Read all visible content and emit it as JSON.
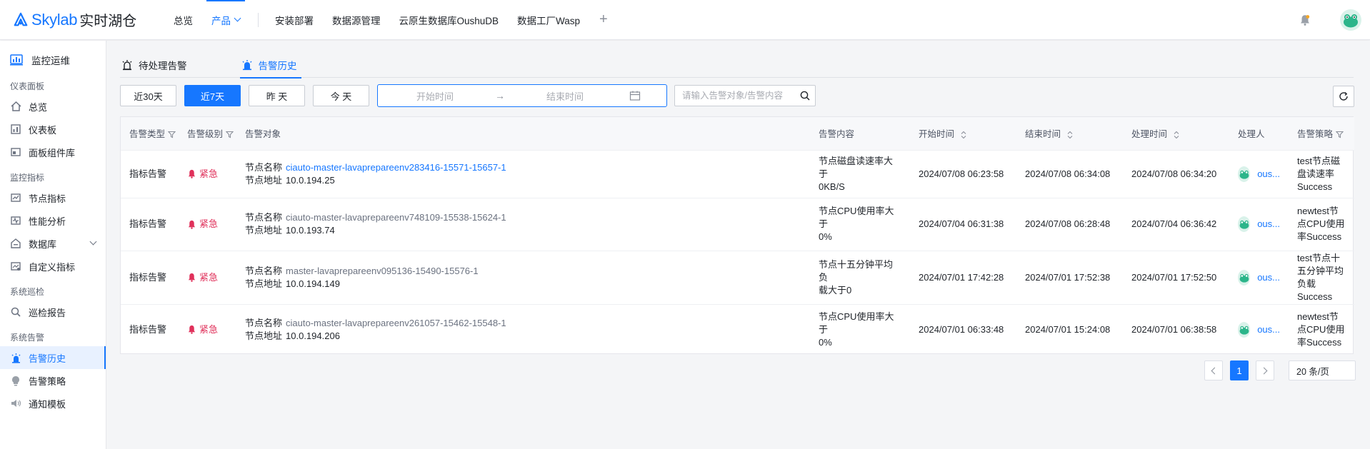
{
  "brand": {
    "name": "Skylab",
    "suffix": "实时湖仓"
  },
  "topnav": {
    "items": [
      "总览",
      "产品",
      "安装部署",
      "数据源管理",
      "云原生数据库OushuDB",
      "数据工厂Wasp"
    ],
    "active": "产品",
    "plus": "+"
  },
  "sidebar": {
    "top": "监控运维",
    "groups": [
      {
        "title": "仪表面板",
        "items": [
          "总览",
          "仪表板",
          "面板组件库"
        ]
      },
      {
        "title": "监控指标",
        "items": [
          "节点指标",
          "性能分析",
          "数据库",
          "自定义指标"
        ]
      },
      {
        "title": "系统巡检",
        "items": [
          "巡检报告"
        ]
      },
      {
        "title": "系统告警",
        "items": [
          "告警历史",
          "告警策略",
          "通知模板"
        ]
      }
    ],
    "active": "告警历史"
  },
  "tabs": [
    "待处理告警",
    "告警历史"
  ],
  "active_tab": "告警历史",
  "filters": {
    "quick": [
      "近30天",
      "近7天",
      "昨 天",
      "今 天"
    ],
    "active_quick": "近7天",
    "start_placeholder": "开始时间",
    "arrow": "→",
    "end_placeholder": "结束时间",
    "search_placeholder": "请输入告警对象/告警内容"
  },
  "table": {
    "headers": [
      "告警类型",
      "告警级别",
      "告警对象",
      "告警内容",
      "开始时间",
      "结束时间",
      "处理时间",
      "处理人",
      "告警策略"
    ],
    "obj_name_key": "节点名称",
    "obj_addr_key": "节点地址",
    "rows": [
      {
        "type": "指标告警",
        "level": "紧急",
        "node_name": "ciauto-master-lavaprepareenv283416-15571-15657-1",
        "node_addr": "10.0.194.25",
        "content": [
          "节点磁盘读速率大于",
          "0KB/S"
        ],
        "start": "2024/07/08 06:23:58",
        "end": "2024/07/08 06:34:08",
        "handled": "2024/07/08 06:34:20",
        "handler": "ous...",
        "policy": [
          "test节点磁",
          "盘读速率",
          "Success"
        ]
      },
      {
        "type": "指标告警",
        "level": "紧急",
        "node_name": "ciauto-master-lavaprepareenv748109-15538-15624-1",
        "node_addr": "10.0.193.74",
        "content": [
          "节点CPU使用率大于",
          "0%"
        ],
        "start": "2024/07/04 06:31:38",
        "end": "2024/07/08 06:28:48",
        "handled": "2024/07/04 06:36:42",
        "handler": "ous...",
        "policy": [
          "newtest节",
          "点CPU使用",
          "率Success"
        ]
      },
      {
        "type": "指标告警",
        "level": "紧急",
        "node_name": "master-lavaprepareenv095136-15490-15576-1",
        "node_addr": "10.0.194.149",
        "content": [
          "节点十五分钟平均负",
          "载大于0"
        ],
        "start": "2024/07/01 17:42:28",
        "end": "2024/07/01 17:52:38",
        "handled": "2024/07/01 17:52:50",
        "handler": "ous...",
        "policy": [
          "test节点十",
          "五分钟平均",
          "负载",
          "Success"
        ]
      },
      {
        "type": "指标告警",
        "level": "紧急",
        "node_name": "ciauto-master-lavaprepareenv261057-15462-15548-1",
        "node_addr": "10.0.194.206",
        "content": [
          "节点CPU使用率大于",
          "0%"
        ],
        "start": "2024/07/01 06:33:48",
        "end": "2024/07/01 15:24:08",
        "handled": "2024/07/01 06:38:58",
        "handler": "ous...",
        "policy": [
          "newtest节",
          "点CPU使用",
          "率Success"
        ]
      }
    ]
  },
  "pagination": {
    "current": "1",
    "page_size": "20 条/页"
  },
  "colors": {
    "accent": "#1677ff",
    "danger": "#e0315b"
  },
  "icons": {
    "logo": "skylab-logo-icon",
    "bell": "bell-icon",
    "avatar": "frog-avatar-icon",
    "refresh": "refresh-icon",
    "search": "search-icon",
    "calendar": "calendar-icon"
  }
}
